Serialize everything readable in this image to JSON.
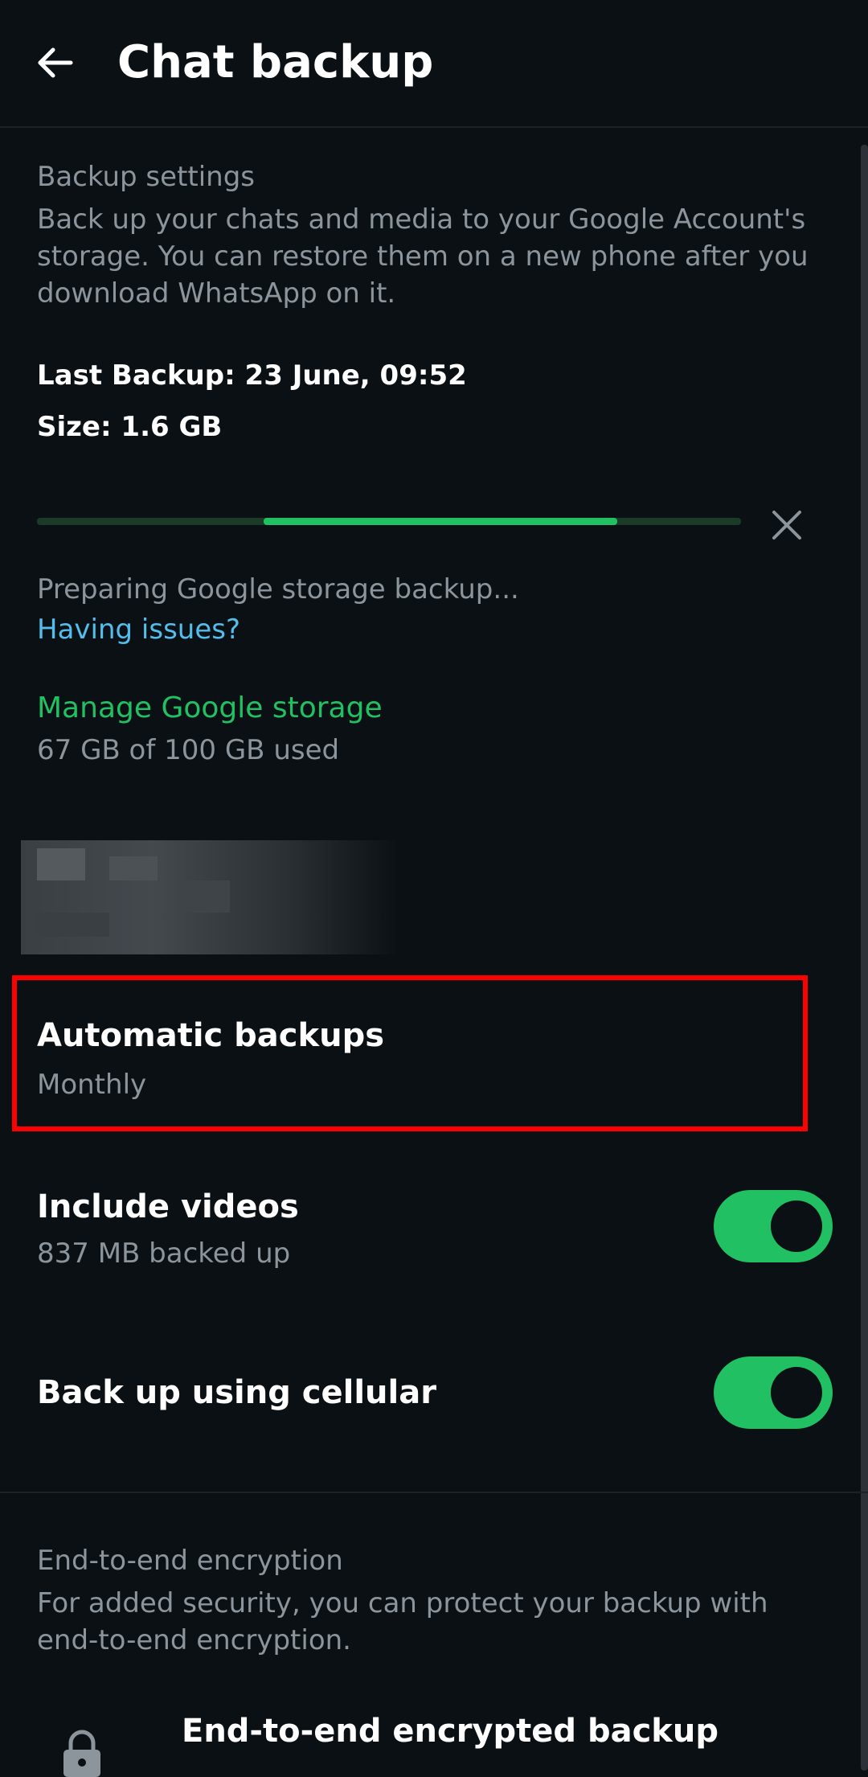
{
  "header": {
    "title": "Chat backup",
    "back_icon": "arrow-left-icon"
  },
  "backup_settings": {
    "title": "Backup settings",
    "description": "Back up your chats and media to your Google Account's storage. You can restore them on a new phone after you download WhatsApp on it.",
    "last_backup": "Last Backup: 23 June, 09:52",
    "size": "Size: 1.6 GB"
  },
  "progress": {
    "fraction": 0.5,
    "status": "Preparing Google storage backup...",
    "issues_link": "Having issues?",
    "cancel_icon": "close-icon"
  },
  "storage": {
    "manage_link": "Manage Google storage",
    "usage": "67 GB of 100 GB used"
  },
  "automatic_backups": {
    "title": "Automatic backups",
    "value": "Monthly"
  },
  "include_videos": {
    "title": "Include videos",
    "subtitle": "837 MB backed up",
    "enabled": true
  },
  "cellular": {
    "title": "Back up using cellular",
    "enabled": true
  },
  "encryption": {
    "title": "End-to-end encryption",
    "description": "For added security, you can protect your backup with end-to-end encryption.",
    "row_title": "End-to-end encrypted backup",
    "icon": "lock-icon"
  },
  "colors": {
    "background": "#0b1014",
    "accent_green": "#21c063",
    "link_blue": "#53bdeb",
    "highlight_red": "#ff0000"
  }
}
